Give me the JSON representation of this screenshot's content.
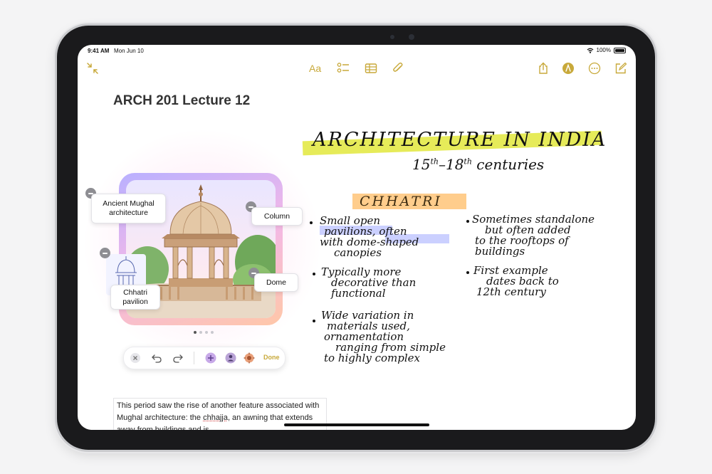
{
  "status_bar": {
    "time": "9:41 AM",
    "date": "Mon Jun 10",
    "battery_text": "100%",
    "battery_level": 1.0
  },
  "toolbar": {
    "items": [
      "collapse-icon",
      "format-text",
      "checklist-icon",
      "table-icon",
      "attachment-icon",
      "share-icon",
      "markup-icon",
      "more-icon",
      "compose-icon"
    ],
    "format_label": "Aa",
    "accent_color": "#c8a93a"
  },
  "note": {
    "title": "ARCH 201 Lecture 12"
  },
  "image_playground": {
    "tags": {
      "mughal": "Ancient Mughal architecture",
      "column": "Column",
      "dome": "Dome",
      "chhatri_pavilion": "Chhatri pavilion"
    },
    "page_count": 4,
    "active_page": 1,
    "toolbar": {
      "done_label": "Done"
    }
  },
  "handwriting": {
    "heading": "ARCHITECTURE IN INDIA",
    "subheading_prefix": "15",
    "subheading_sup1": "th",
    "subheading_mid": "–18",
    "subheading_sup2": "th",
    "subheading_suffix": "centuries",
    "section_title": "CHHATRI",
    "left_bullets": [
      [
        "Small open",
        "pavilions, often",
        "with dome-shaped",
        "canopies"
      ],
      [
        "Typically more",
        "decorative than",
        "functional"
      ],
      [
        "Wide variation in",
        "materials used,",
        "ornamentation",
        "ranging from simple",
        "to highly complex"
      ]
    ],
    "right_bullets": [
      [
        "Sometimes standalone",
        "but often added",
        "to the rooftops of",
        "buildings"
      ],
      [
        "First example",
        "dates back to",
        "12th century"
      ]
    ]
  },
  "body_text": {
    "before": "This period saw the rise of another feature associated with Mughal architecture: the ",
    "term": "chhajja",
    "after": ", an awning that extends away from buildings and is"
  }
}
